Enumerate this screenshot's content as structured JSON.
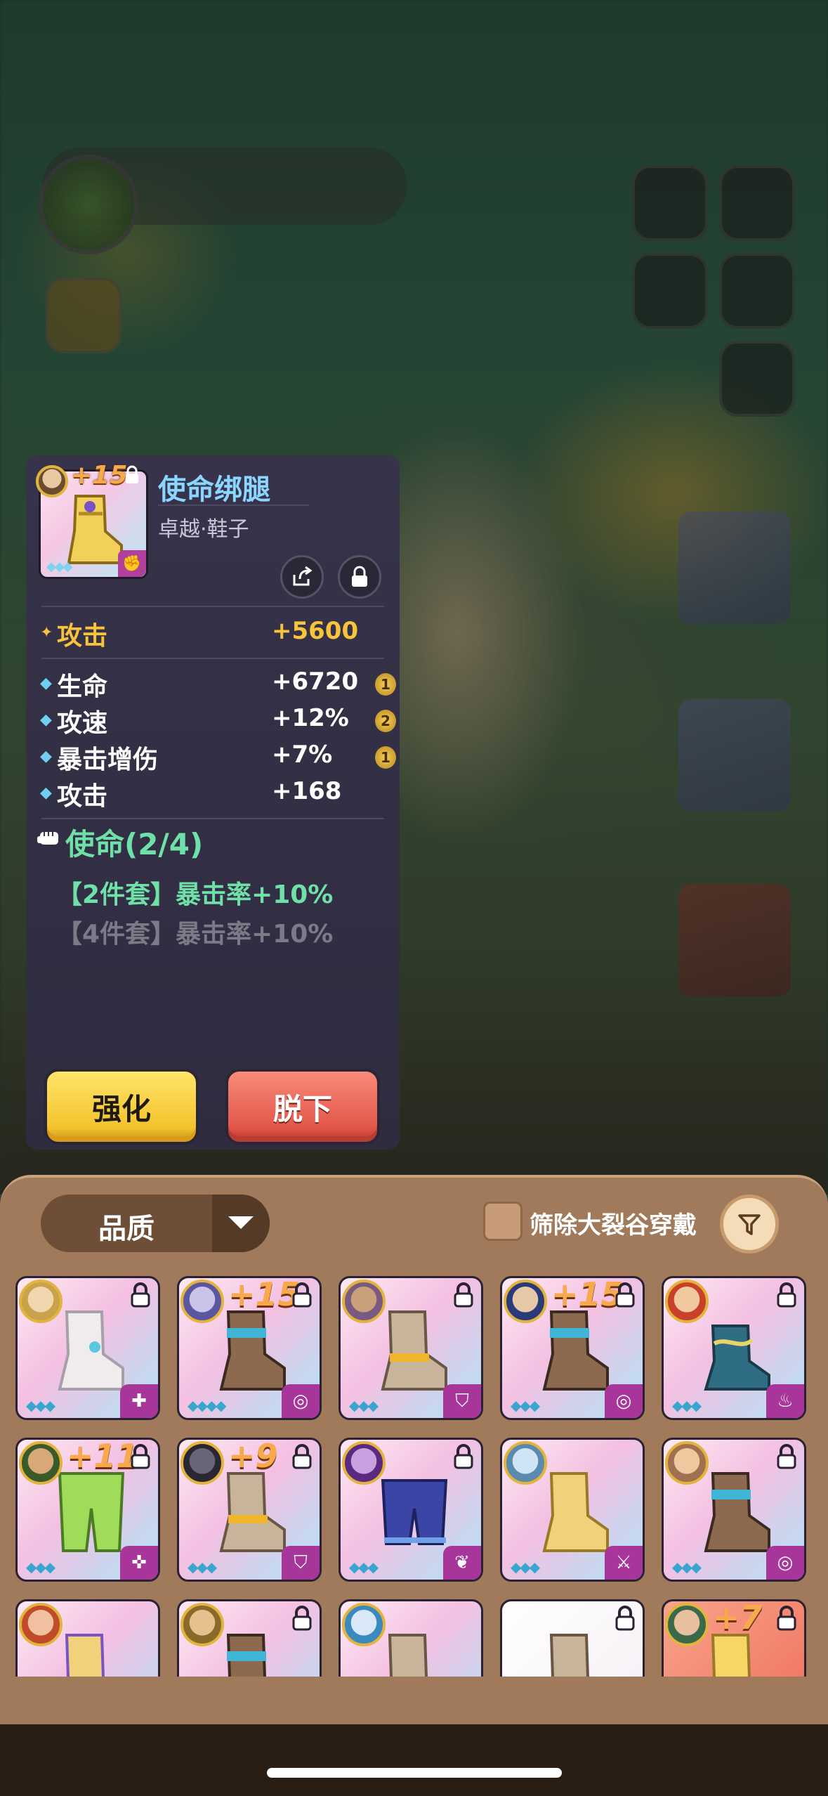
{
  "detail": {
    "plus_level": "+15",
    "name": "使命绑腿",
    "subtitle": "卓越·鞋子",
    "main_stat": {
      "label": "攻击",
      "value": "+5600"
    },
    "sub_stats": [
      {
        "label": "生命",
        "value": "+6720",
        "rank": "1"
      },
      {
        "label": "攻速",
        "value": "+12%",
        "rank": "2"
      },
      {
        "label": "暴击增伤",
        "value": "+7%",
        "rank": "1"
      },
      {
        "label": "攻击",
        "value": "+168",
        "rank": ""
      }
    ],
    "set_title": "使命(2/4)",
    "set_bonus_2": "【2件套】暴击率+10%",
    "set_bonus_4": "【4件套】暴击率+10%",
    "enhance_label": "强化",
    "unequip_label": "脱下"
  },
  "inventory": {
    "filter_label": "品质",
    "exclude_label": "筛除大裂谷穿戴",
    "items": [
      {
        "level": "",
        "badge": "plus-circle",
        "bg": "pink"
      },
      {
        "level": "+15",
        "badge": "swirl",
        "bg": "pink"
      },
      {
        "level": "",
        "badge": "shield",
        "bg": "pink"
      },
      {
        "level": "+15",
        "badge": "swirl",
        "bg": "pink"
      },
      {
        "level": "",
        "badge": "flame",
        "bg": "pink"
      },
      {
        "level": "+11",
        "badge": "cross",
        "bg": "pink"
      },
      {
        "level": "+9",
        "badge": "shield",
        "bg": "pink"
      },
      {
        "level": "",
        "badge": "wings",
        "bg": "pink"
      },
      {
        "level": "",
        "badge": "sword",
        "bg": "pink"
      },
      {
        "level": "",
        "badge": "swirl",
        "bg": "pink"
      },
      {
        "level": "",
        "badge": "",
        "bg": "pink"
      },
      {
        "level": "",
        "badge": "",
        "bg": "pink"
      },
      {
        "level": "",
        "badge": "",
        "bg": "pink"
      },
      {
        "level": "",
        "badge": "",
        "bg": "white"
      },
      {
        "level": "+7",
        "badge": "",
        "bg": "orange"
      }
    ]
  },
  "colors": {
    "accent_blue": "#8ad6ff",
    "set_green": "#6fe1a8",
    "gold": "#f7c43b"
  }
}
